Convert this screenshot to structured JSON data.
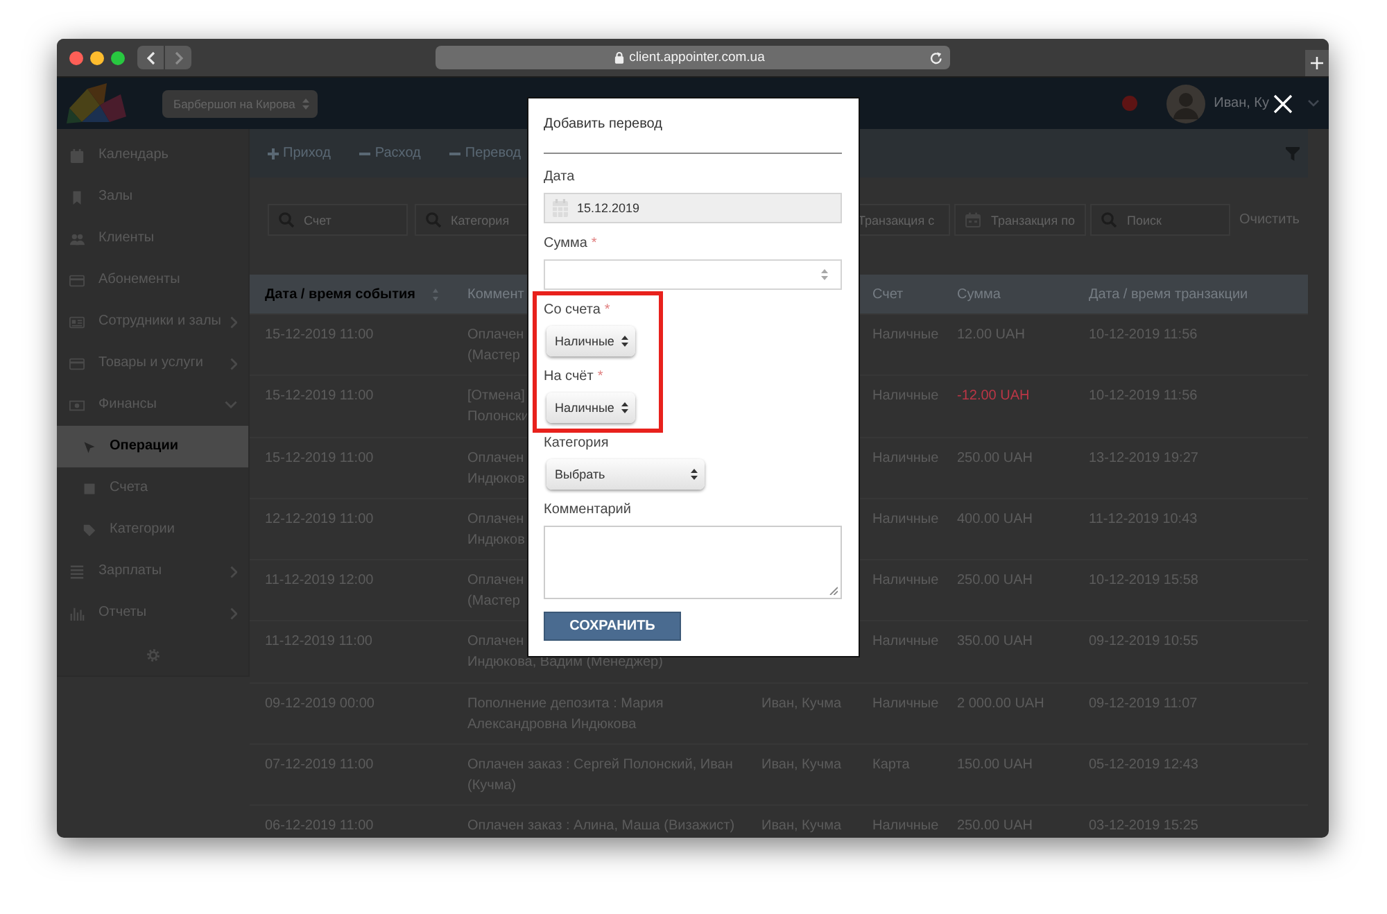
{
  "browser": {
    "url": "client.appointer.com.ua"
  },
  "header": {
    "branch": "Барбершоп на Кирова",
    "user_name": "Иван, Ку"
  },
  "sidebar": {
    "items": [
      {
        "kind": "link",
        "label": "Календарь",
        "selected": false
      },
      {
        "kind": "link",
        "label": "Залы",
        "selected": false
      },
      {
        "kind": "link",
        "label": "Клиенты",
        "selected": false
      },
      {
        "kind": "link",
        "label": "Абонементы",
        "selected": false
      },
      {
        "kind": "group",
        "label": "Сотрудники и залы",
        "selected": false,
        "expanded": false
      },
      {
        "kind": "group",
        "label": "Товары и услуги",
        "selected": false,
        "expanded": false
      },
      {
        "kind": "group",
        "label": "Финансы",
        "selected": false,
        "expanded": true,
        "children": [
          {
            "label": "Операции",
            "selected": true
          },
          {
            "label": "Счета",
            "selected": false
          },
          {
            "label": "Категории",
            "selected": false
          }
        ]
      },
      {
        "kind": "group",
        "label": "Зарплаты",
        "selected": false,
        "expanded": false
      },
      {
        "kind": "group",
        "label": "Отчеты",
        "selected": false,
        "expanded": false
      }
    ]
  },
  "toolbar": {
    "actions": [
      {
        "kind": "add",
        "label": "Приход"
      },
      {
        "kind": "subtract",
        "label": "Расход"
      },
      {
        "kind": "subtract",
        "label": "Перевод"
      }
    ]
  },
  "filters": {
    "left": [
      {
        "kind": "search",
        "placeholder": "Счет"
      },
      {
        "kind": "search",
        "placeholder": "Категория"
      }
    ],
    "right": [
      {
        "kind": "text",
        "placeholder": "Транзакция с"
      },
      {
        "kind": "date",
        "placeholder": "Транзакция по"
      },
      {
        "kind": "search",
        "placeholder": "Поиск"
      }
    ],
    "clear": "Очистить"
  },
  "table": {
    "columns": {
      "event_time": {
        "label": "Дата / время события",
        "sorted": true
      },
      "comment": {
        "label": "Коммент",
        "sorted": false
      },
      "account": {
        "label": "Счет",
        "sorted": false
      },
      "amount": {
        "label": "Сумма",
        "sorted": false
      },
      "transaction_time": {
        "label": "Дата / время транзакции",
        "sorted": false
      }
    },
    "rows": [
      {
        "event_time": "15-12-2019 11:00",
        "comment": [
          "Оплачен",
          "(Мастер"
        ],
        "account": "Наличные",
        "amount": "12.00 UAH",
        "negative": false,
        "transaction_time": "10-12-2019 11:56"
      },
      {
        "event_time": "15-12-2019 11:00",
        "comment": [
          "[Отмена]",
          "Полонски"
        ],
        "account": "Наличные",
        "amount": "-12.00 UAH",
        "negative": true,
        "transaction_time": "10-12-2019 11:56"
      },
      {
        "event_time": "15-12-2019 11:00",
        "comment": [
          "Оплачен",
          "Индюков"
        ],
        "account": "Наличные",
        "amount": "250.00 UAH",
        "negative": false,
        "transaction_time": "13-12-2019 19:27"
      },
      {
        "event_time": "12-12-2019 11:00",
        "comment": [
          "Оплачен",
          "Индюков"
        ],
        "account": "Наличные",
        "amount": "400.00 UAH",
        "negative": false,
        "transaction_time": "11-12-2019 10:43"
      },
      {
        "event_time": "11-12-2019 12:00",
        "comment": [
          "Оплачен",
          "(Мастер"
        ],
        "account": "Наличные",
        "amount": "250.00 UAH",
        "negative": false,
        "transaction_time": "10-12-2019 15:58"
      },
      {
        "event_time": "11-12-2019 11:00",
        "comment": [
          "Оплачен",
          "Индюкова, Вадим (Менеджер)"
        ],
        "account": "Наличные",
        "amount": "350.00 UAH",
        "negative": false,
        "transaction_time": "09-12-2019 10:55"
      },
      {
        "event_time": "09-12-2019 00:00",
        "comment": [
          "Пополнение депозита : Мария",
          "Александровна Индюкова"
        ],
        "employee": "Иван, Кучма",
        "account": "Наличные",
        "amount": "2 000.00 UAH",
        "negative": false,
        "transaction_time": "09-12-2019 11:07"
      },
      {
        "event_time": "07-12-2019 11:00",
        "comment": [
          "Оплачен заказ : Сергей Полонский, Иван",
          "(Кучма)"
        ],
        "employee": "Иван, Кучма",
        "account": "Карта",
        "amount": "150.00 UAH",
        "negative": false,
        "transaction_time": "05-12-2019 12:43"
      },
      {
        "event_time": "06-12-2019 11:00",
        "comment": [
          "Оплачен заказ : Алина, Маша (Визажист)"
        ],
        "employee": "Иван, Кучма",
        "account": "Наличные",
        "amount": "250.00 UAH",
        "negative": false,
        "transaction_time": "03-12-2019 15:25"
      }
    ]
  },
  "modal": {
    "title": "Добавить перевод",
    "fields": [
      {
        "kind": "date",
        "label": "Дата",
        "value": "15.12.2019",
        "highlighted": false
      },
      {
        "kind": "number",
        "label": "Сумма",
        "required_mark": "*",
        "highlighted": false
      },
      {
        "kind": "select",
        "label": "Со счета",
        "required_mark": "*",
        "value": "Наличные",
        "highlighted": true
      },
      {
        "kind": "select",
        "label": "На счёт",
        "required_mark": "*",
        "value": "Наличные",
        "highlighted": true
      },
      {
        "kind": "select",
        "label": "Категория",
        "value": "Выбрать",
        "highlighted": false
      },
      {
        "kind": "textarea",
        "label": "Комментарий",
        "highlighted": false
      }
    ],
    "submit": "СОХРАНИТЬ"
  }
}
